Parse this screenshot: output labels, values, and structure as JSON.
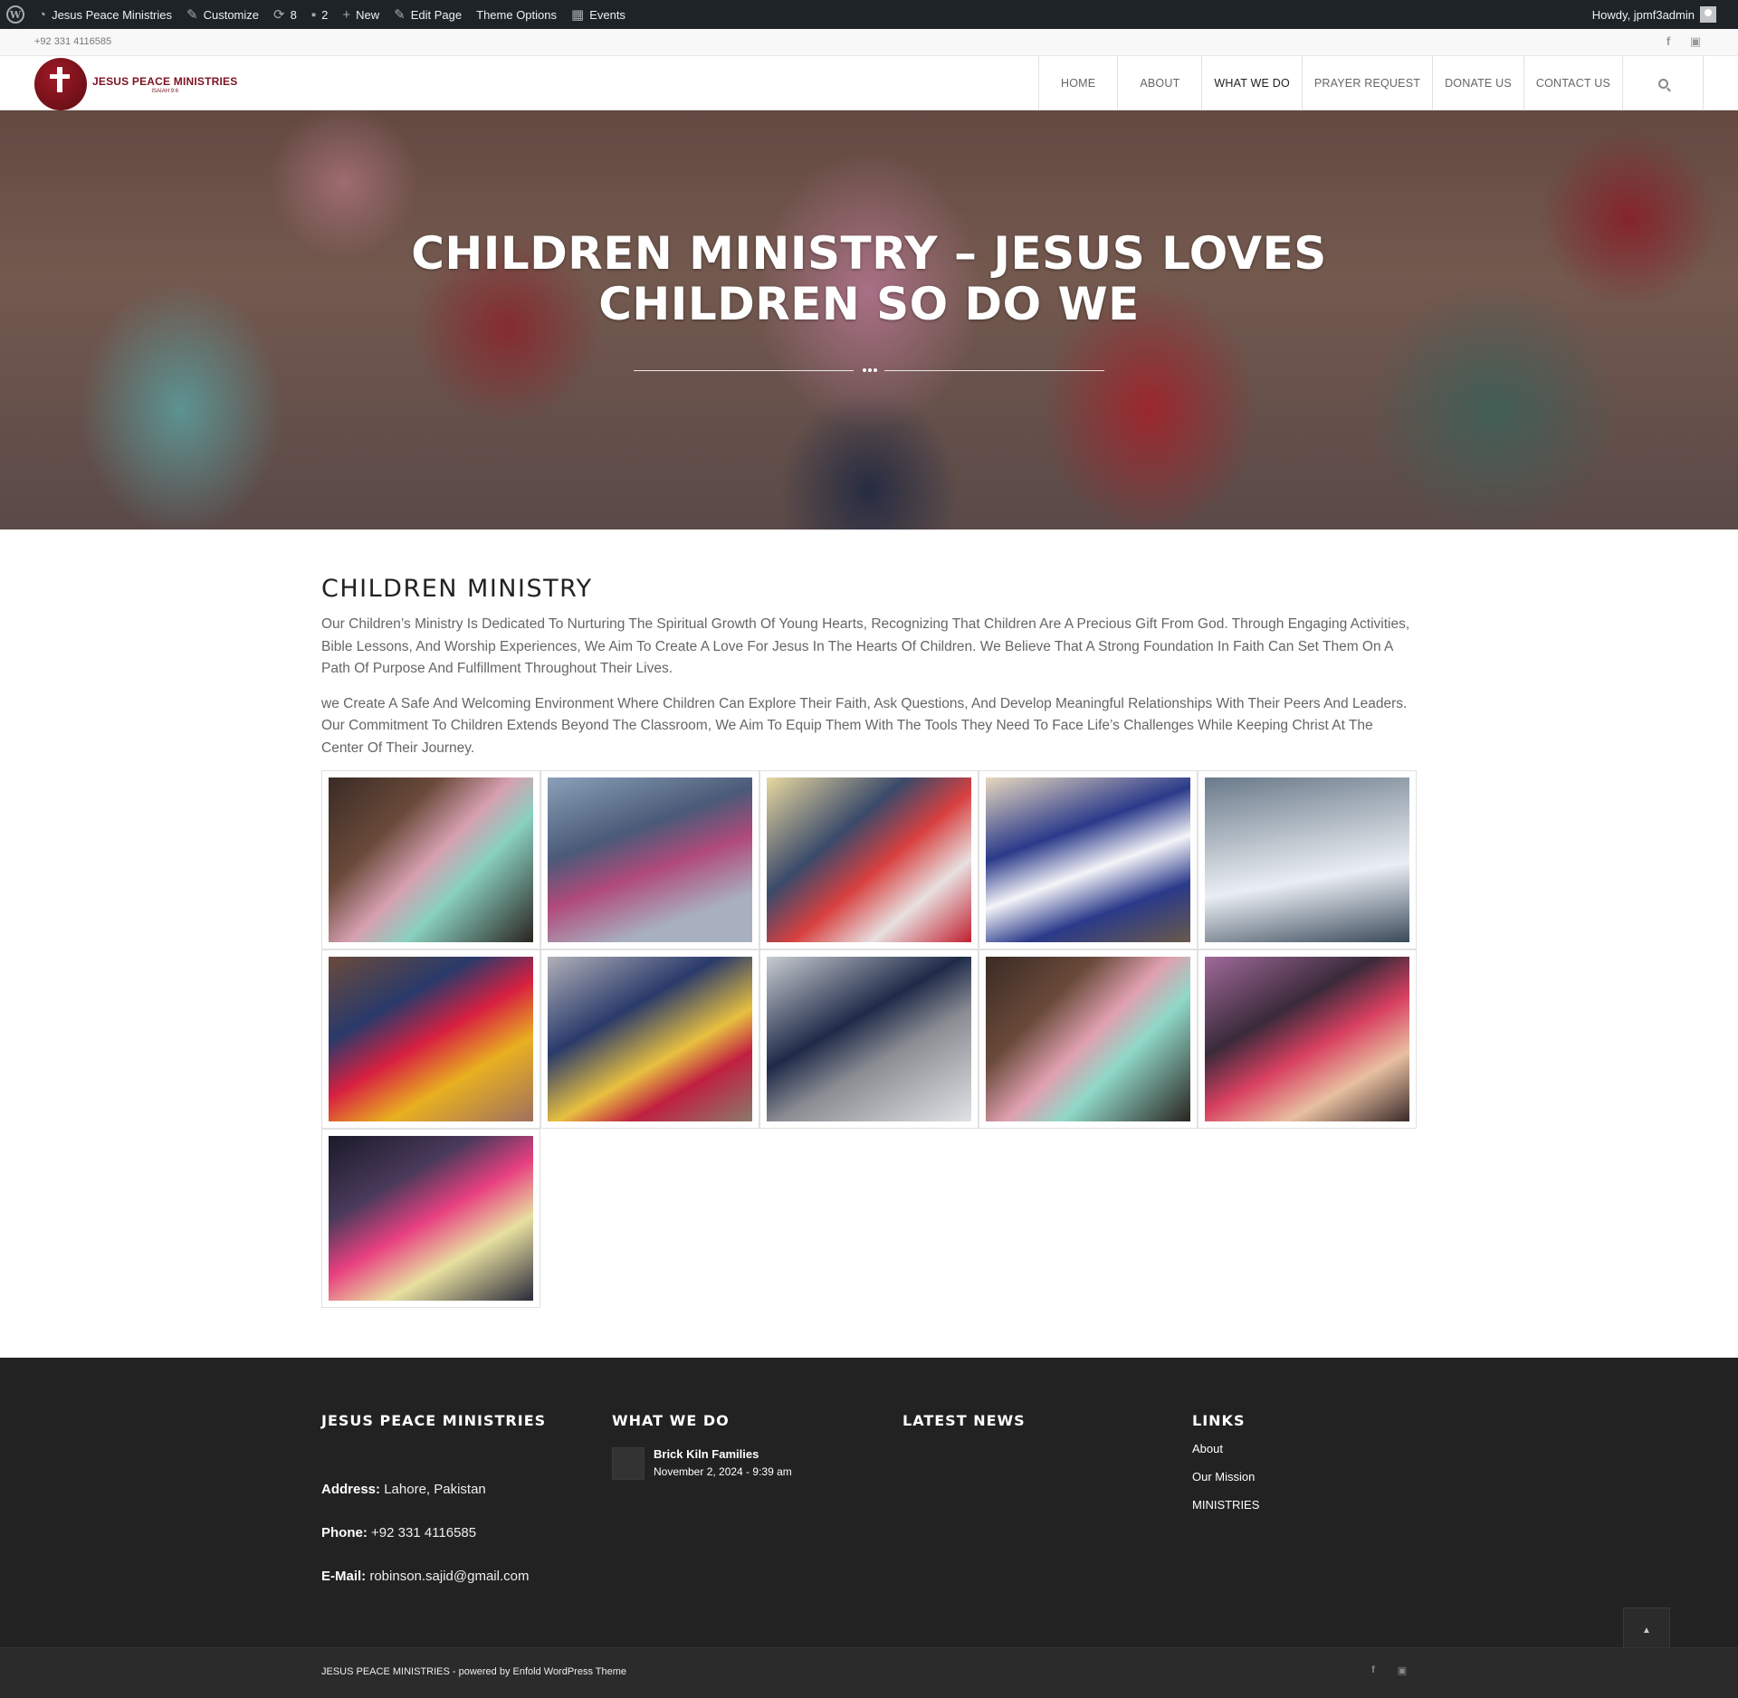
{
  "admin_bar": {
    "site_name": "Jesus Peace Ministries",
    "customize": "Customize",
    "updates_count": "8",
    "comments_count": "2",
    "new": "New",
    "edit_page": "Edit Page",
    "theme_options": "Theme Options",
    "events": "Events",
    "howdy": "Howdy, jpmf3admin"
  },
  "topbar": {
    "phone": "+92 331 4116585",
    "socials": [
      "facebook-icon",
      "youtube-icon"
    ]
  },
  "header": {
    "logo_title": "JESUS PEACE MINISTRIES",
    "logo_sub": "ISAIAH 9:6",
    "nav": [
      "HOME",
      "ABOUT",
      "WHAT WE DO",
      "PRAYER REQUEST",
      "DONATE US",
      "CONTACT US"
    ],
    "active_nav": "WHAT WE DO"
  },
  "hero": {
    "title": "CHILDREN MINISTRY – JESUS LOVES CHILDREN SO DO WE"
  },
  "main": {
    "section_title": "CHILDREN MINISTRY",
    "paragraph_1": "Our Children’s Ministry Is Dedicated To Nurturing The Spiritual Growth Of Young Hearts, Recognizing That Children Are A Precious Gift From God. Through Engaging Activities, Bible Lessons, And Worship Experiences, We Aim To Create A Love For Jesus In The Hearts Of Children. We Believe That A Strong Foundation In Faith Can Set Them On A Path Of Purpose And Fulfillment Throughout Their Lives.",
    "paragraph_2": "we Create A Safe And Welcoming Environment Where Children Can Explore Their Faith, Ask Questions, And Develop Meaningful Relationships With Their Peers And Leaders. Our Commitment To Children Extends Beyond The Classroom, We Aim To Equip Them With The Tools They Need To Face Life’s Challenges While Keeping Christ At The Center Of Their Journey.",
    "gallery_count": 11
  },
  "footer": {
    "col1": {
      "heading": "JESUS PEACE MINISTRIES",
      "address_label": "Address:",
      "address": "Lahore, Pakistan",
      "phone_label": "Phone:",
      "phone": "+92 331 4116585",
      "email_label": "E-Mail:",
      "email": "robinson.sajid@gmail.com"
    },
    "col2": {
      "heading": "WHAT WE DO",
      "news_title": "Brick Kiln Families",
      "news_date": "November 2, 2024 - 9:39 am"
    },
    "col3": {
      "heading": "LATEST NEWS"
    },
    "col4": {
      "heading": "LINKS",
      "links": [
        "About",
        "Our Mission",
        "MINISTRIES"
      ]
    }
  },
  "socket": {
    "text": "JESUS PEACE MINISTRIES - powered by Enfold WordPress Theme"
  }
}
